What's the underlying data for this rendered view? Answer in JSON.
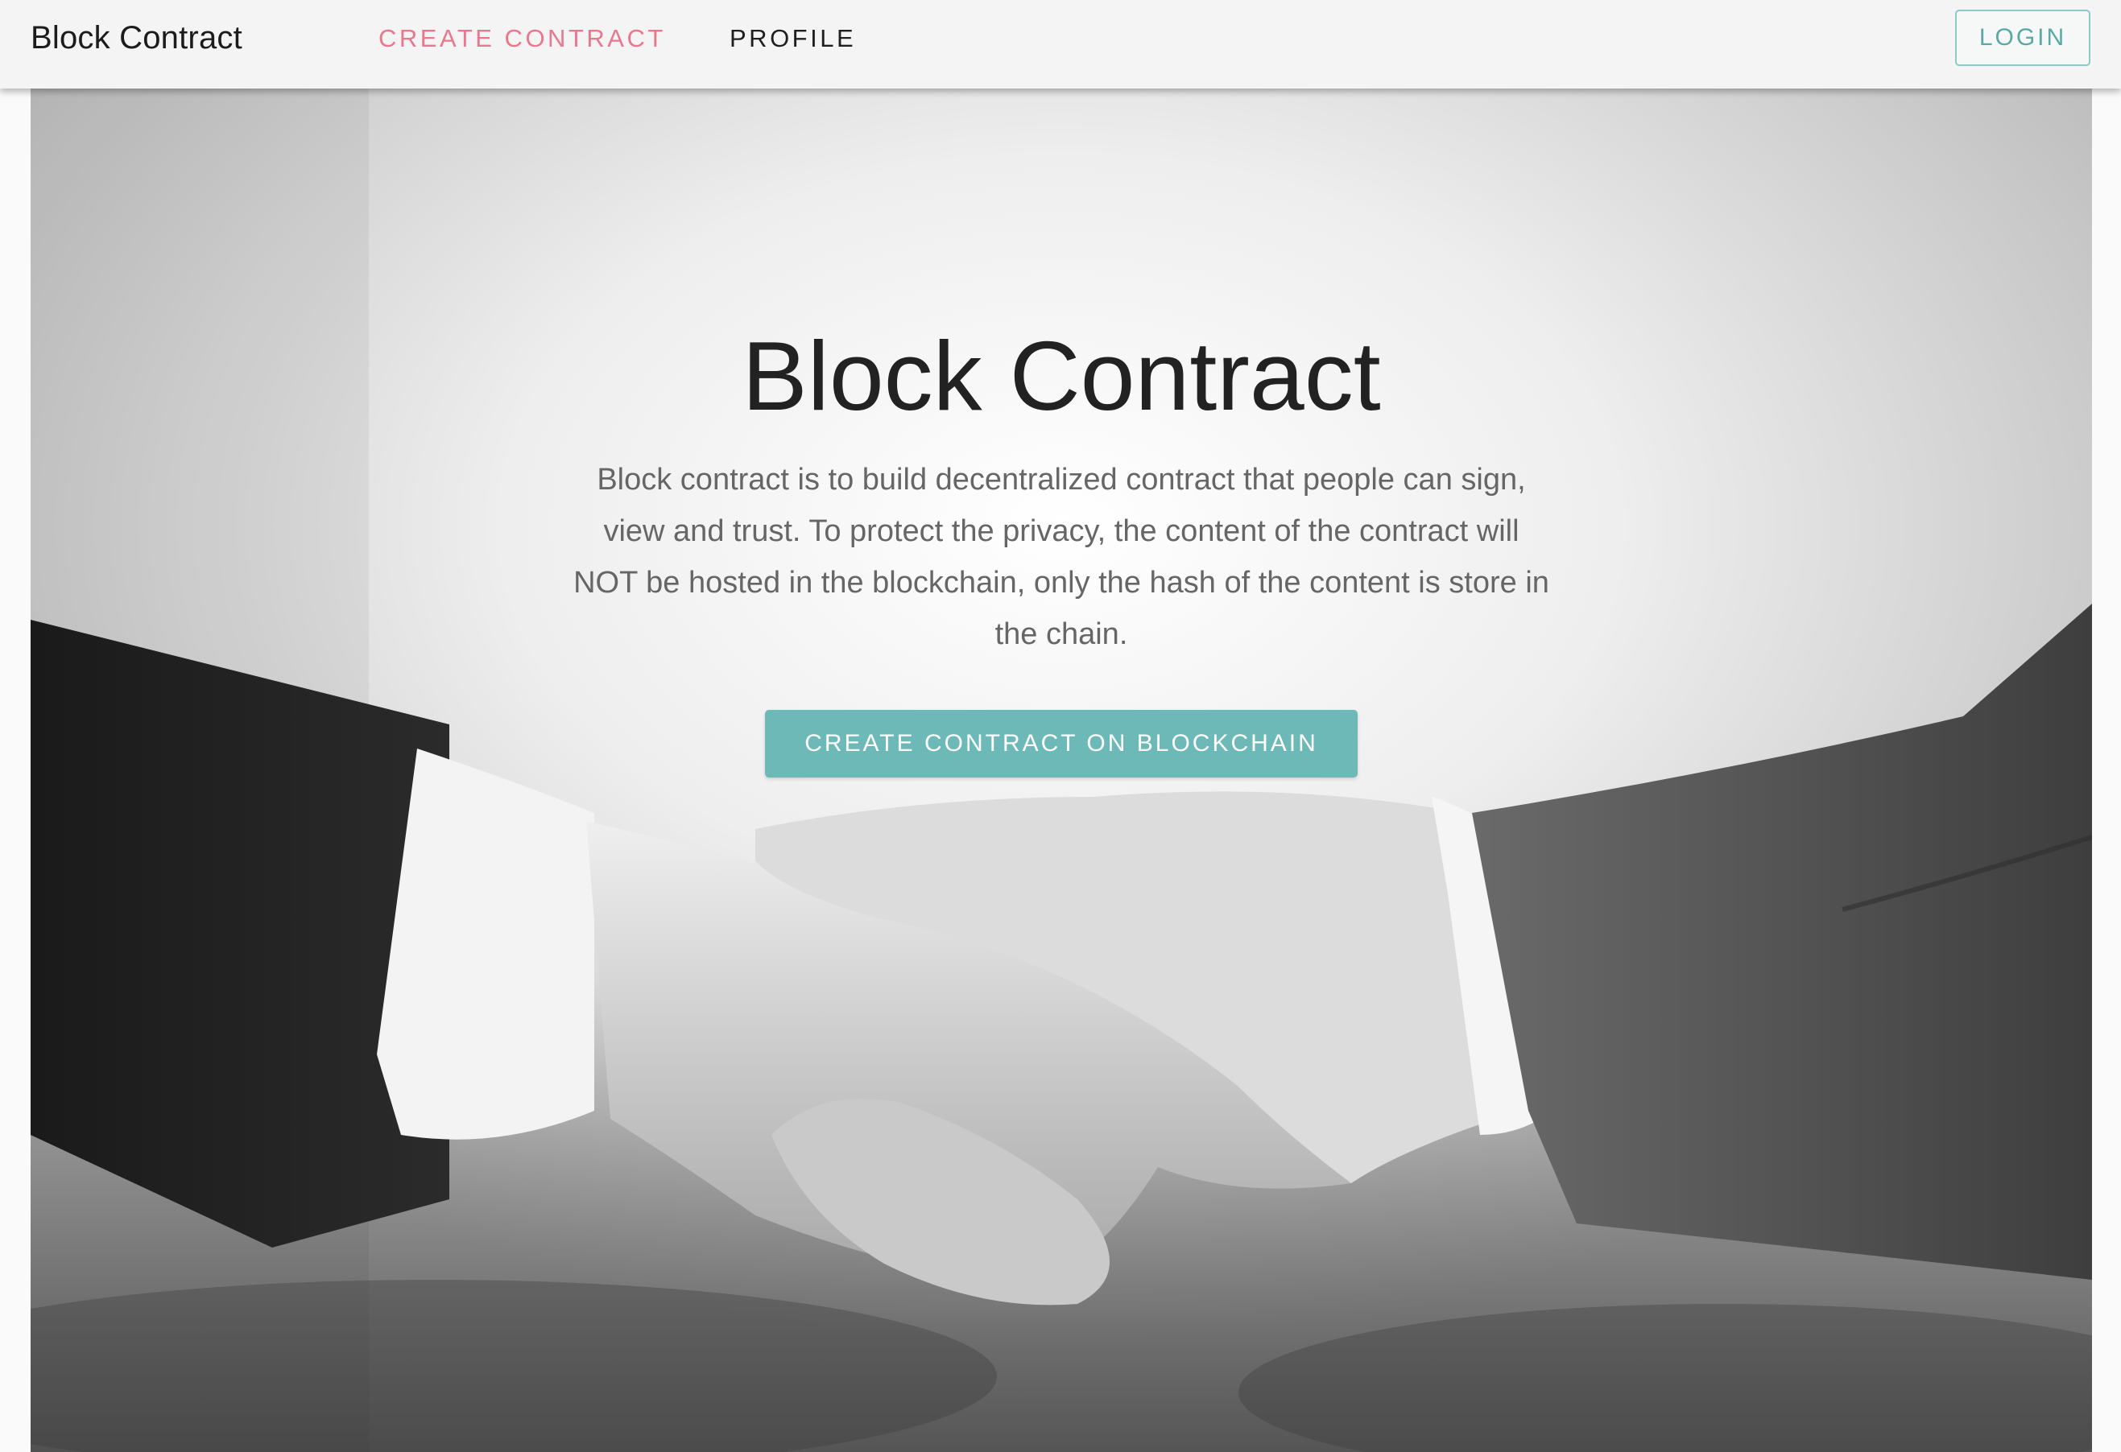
{
  "navbar": {
    "brand": "Block Contract",
    "links": [
      {
        "label": "CREATE CONTRACT",
        "active": true
      },
      {
        "label": "PROFILE",
        "active": false
      }
    ],
    "login_label": "LOGIN"
  },
  "hero": {
    "title": "Block Contract",
    "description": "Block contract is to build decentralized contract that people can sign, view and trust. To protect the privacy, the content of the contract will NOT be hosted in the blockchain, only the hash of the content is store in the chain.",
    "cta_label": "CREATE CONTRACT ON BLOCKCHAIN",
    "background_image": "handshake-photo"
  },
  "colors": {
    "accent": "#6cb9b7",
    "active_link": "#e9788f",
    "nav_background": "#f4f4f4"
  }
}
